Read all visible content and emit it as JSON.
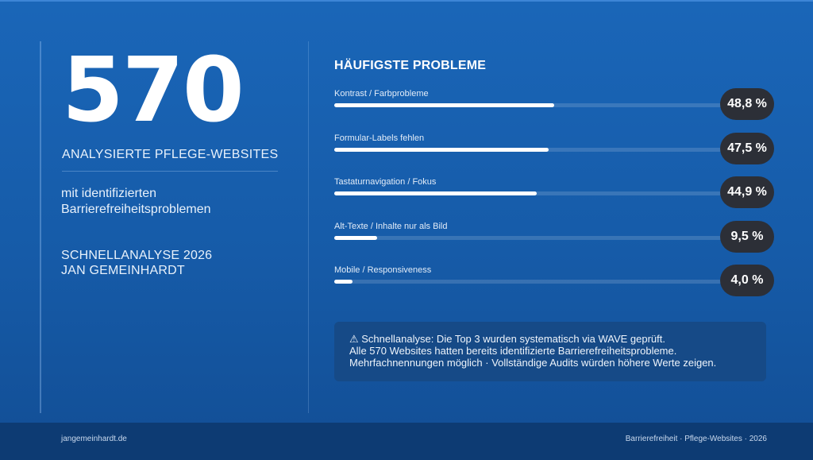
{
  "hero": {
    "number": "570",
    "caption": "ANALYSIERTE PFLEGE-WEBSITES",
    "description": "mit identifizierten Barrierefreiheitsproblemen",
    "meta_line1": "SCHNELLANALYSE 2026",
    "meta_line2": "JAN GEMEINHARDT"
  },
  "chart_data": {
    "type": "bar",
    "title": "HÄUFIGSTE PROBLEME",
    "categories": [
      "Kontrast / Farbprobleme",
      "Formular-Labels fehlen",
      "Tastaturnavigation / Fokus",
      "Alt-Texte / Inhalte nur als Bild",
      "Mobile / Responsiveness"
    ],
    "values": [
      48.8,
      47.5,
      44.9,
      9.5,
      4.0
    ],
    "value_labels": [
      "48,8 %",
      "47,5 %",
      "44,9 %",
      "9,5 %",
      "4,0 %"
    ],
    "ylim": [
      0,
      86
    ],
    "orientation": "horizontal"
  },
  "note": {
    "line1": "⚠ Schnellanalyse: Die Top 3 wurden systematisch via WAVE geprüft.",
    "line2": "Alle 570 Websites hatten bereits identifizierte Barrierefreiheitsprobleme.",
    "line3": "Mehrfachnennungen möglich · Vollständige Audits würden höhere Werte zeigen."
  },
  "footer": {
    "left": "jangemeinhardt.de",
    "right": "Barrierefreiheit · Pflege-Websites · 2026"
  },
  "colors": {
    "background": "#1a66b8",
    "footer": "#0d3b73",
    "pill": "#2c2f37",
    "bar_fill": "#ffffff",
    "note_box": "#164a87"
  }
}
